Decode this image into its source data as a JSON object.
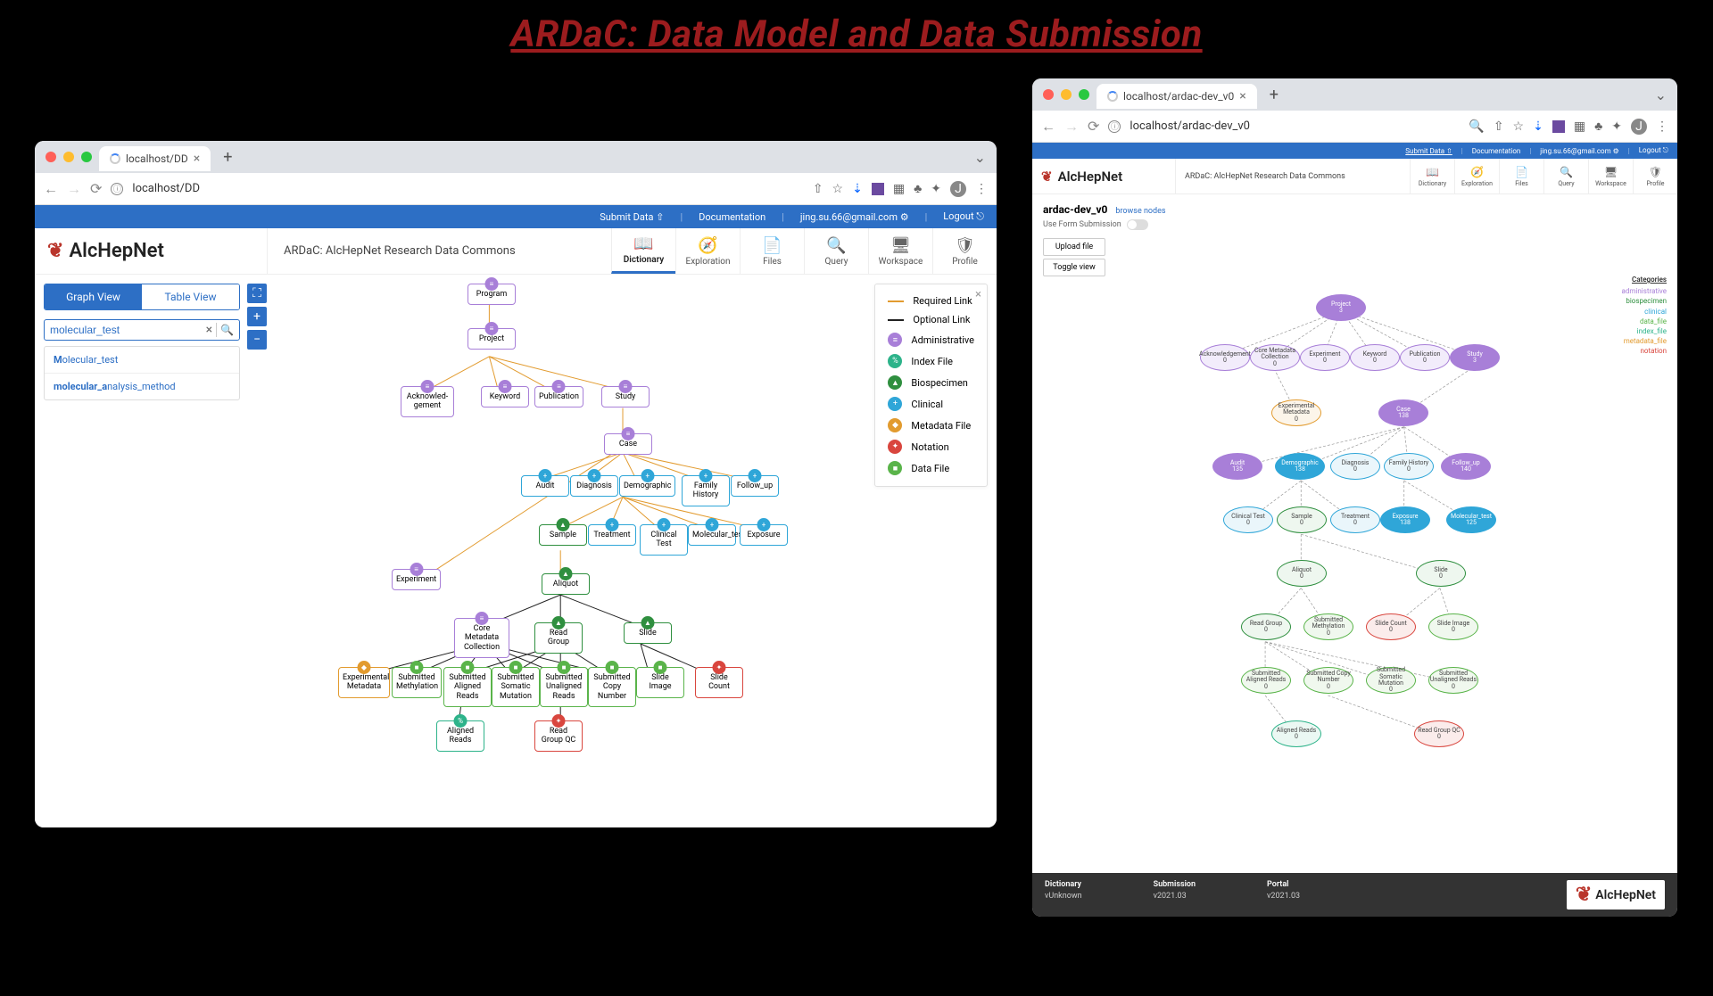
{
  "title": "ARDaC: Data Model and Data Submission",
  "win1": {
    "tab": "localhost/DD",
    "url": "localhost/DD",
    "util": {
      "submit": "Submit Data",
      "docs": "Documentation",
      "email": "jing.su.66@gmail.com",
      "logout": "Logout"
    },
    "brand": "AlcHepNet",
    "app_title": "ARDaC: AlcHepNet Research Data Commons",
    "nav": [
      "Dictionary",
      "Exploration",
      "Files",
      "Query",
      "Workspace",
      "Profile"
    ],
    "toggle": {
      "graph": "Graph View",
      "table": "Table View"
    },
    "search": {
      "value": "molecular_test",
      "sugg1_a": "M",
      "sugg1_b": "olecular_test",
      "sugg2_a": "molecular_a",
      "sugg2_b": "nalysis_method"
    },
    "legend": {
      "required": "Required Link",
      "optional": "Optional Link",
      "admin": "Administrative",
      "index": "Index File",
      "bio": "Biospecimen",
      "clin": "Clinical",
      "meta": "Metadata File",
      "not": "Notation",
      "data": "Data File"
    },
    "nodes": {
      "program": "Program",
      "project": "Project",
      "ack": "Acknowled-gement",
      "keyword": "Keyword",
      "publication": "Publication",
      "study": "Study",
      "case": "Case",
      "audit": "Audit",
      "diagnosis": "Diagnosis",
      "demographic": "Demographic",
      "family": "Family History",
      "followup": "Follow_up",
      "sample": "Sample",
      "treatment": "Treatment",
      "clintest": "Clinical Test",
      "moltest": "Molecular_test",
      "exposure": "Exposure",
      "experiment": "Experiment",
      "aliquot": "Aliquot",
      "cmc": "Core Metadata Collection",
      "readgroup": "Read Group",
      "slide": "Slide",
      "expmeta": "Experimental Metadata",
      "submeth": "Submitted Methylation",
      "subalign": "Submitted Aligned Reads",
      "subsom": "Submitted Somatic Mutation",
      "subunalign": "Submitted Unaligned Reads",
      "subcopy": "Submitted Copy Number",
      "slideimg": "Slide Image",
      "slidecount": "Slide Count",
      "alignreads": "Aligned Reads",
      "readgroupqc": "Read Group QC"
    }
  },
  "win2": {
    "tab": "localhost/ardac-dev_v0",
    "url": "localhost/ardac-dev_v0",
    "util": {
      "submit": "Submit Data",
      "docs": "Documentation",
      "email": "jing.su.66@gmail.com",
      "logout": "Logout"
    },
    "brand": "AlcHepNet",
    "app_title": "ARDaC: AlcHepNet Research Data Commons",
    "nav": [
      "Dictionary",
      "Exploration",
      "Files",
      "Query",
      "Workspace",
      "Profile"
    ],
    "page_title": "ardac-dev_v0",
    "browse": "browse nodes",
    "form_label": "Use Form Submission",
    "btn_upload": "Upload file",
    "btn_toggle": "Toggle view",
    "cat": {
      "title": "Categories",
      "admin": "administrative",
      "bio": "biospecimen",
      "clin": "clinical",
      "data": "data_file",
      "index": "index_file",
      "meta": "metadata_file",
      "not": "notation"
    },
    "nodes": {
      "project": "Project",
      "ack": "Acknowledgement",
      "cmc": "Core Metadata Collection",
      "experiment": "Experiment",
      "keyword": "Keyword",
      "publication": "Publication",
      "study": "Study",
      "expmeta": "Experimental Metadata",
      "case": "Case",
      "audit": "Audit",
      "demographic": "Demographic",
      "diagnosis": "Diagnosis",
      "family": "Family History",
      "followup": "Follow_up",
      "clintest": "Clinical Test",
      "sample": "Sample",
      "treatment": "Treatment",
      "exposure": "Exposure",
      "moltest": "Molecular_test",
      "aliquot": "Aliquot",
      "slide": "Slide",
      "readgroup": "Read Group",
      "submeth": "Submitted Methylation",
      "slidecount": "Slide Count",
      "slideimg": "Slide Image",
      "subalign": "Submitted Aligned Reads",
      "subcopy": "Submitted Copy Number",
      "subsom": "Submitted Somatic Mutation",
      "subunalign": "Submitted Unaligned Reads",
      "alignreads": "Aligned Reads",
      "readgroupqc": "Read Group QC"
    },
    "footer": {
      "dict": "Dictionary",
      "dictv": "vUnknown",
      "sub": "Submission",
      "subv": "v2021.03",
      "portal": "Portal",
      "portalv": "v2021.03"
    }
  }
}
